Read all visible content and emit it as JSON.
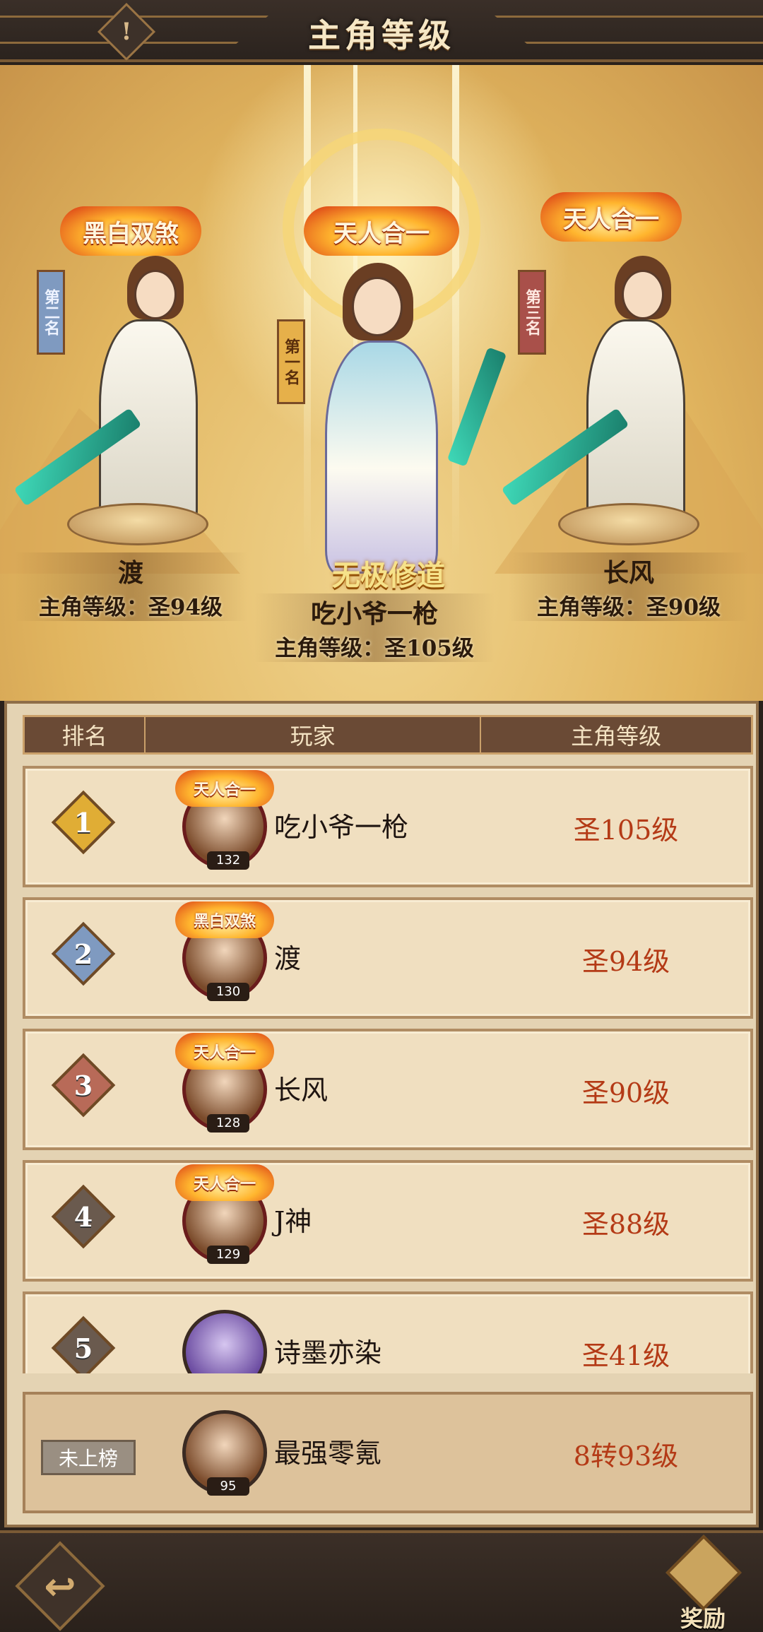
{
  "header": {
    "title": "主角等级",
    "info_icon": "exclamation-icon"
  },
  "podium": [
    {
      "place_label": "第二名",
      "badge": "黑白双煞",
      "name": "渡",
      "level_text": "主角等级：圣94级"
    },
    {
      "place_label": "第一名",
      "badge": "天人合一",
      "title": "无极修道",
      "name": "吃小爷一枪",
      "level_text": "主角等级：圣105级"
    },
    {
      "place_label": "第三名",
      "badge": "天人合一",
      "name": "长风",
      "level_text": "主角等级：圣90级"
    }
  ],
  "table": {
    "headers": [
      "排名",
      "玩家",
      "主角等级"
    ],
    "rows": [
      {
        "rank": "1",
        "badge": "天人合一",
        "avatar_level": "132",
        "name": "吃小爷一枪",
        "level": "圣105级"
      },
      {
        "rank": "2",
        "badge": "黑白双煞",
        "avatar_level": "130",
        "name": "渡",
        "level": "圣94级"
      },
      {
        "rank": "3",
        "badge": "天人合一",
        "avatar_level": "128",
        "name": "长风",
        "level": "圣90级"
      },
      {
        "rank": "4",
        "badge": "天人合一",
        "avatar_level": "129",
        "name": "J神",
        "level": "圣88级"
      },
      {
        "rank": "5",
        "name": "诗墨亦染",
        "level": "圣41级"
      }
    ]
  },
  "self": {
    "status": "未上榜",
    "avatar_level": "95",
    "name": "最强零氪",
    "level": "8转93级"
  },
  "footer": {
    "back_icon": "back-arrow-icon",
    "reward_label": "奖励"
  },
  "colors": {
    "level_red": "#b43a16",
    "rank1": "#e0ad35",
    "rank2": "#7f9ac0",
    "rank3": "#b86a58",
    "rank_other": "#6a5a4e"
  }
}
